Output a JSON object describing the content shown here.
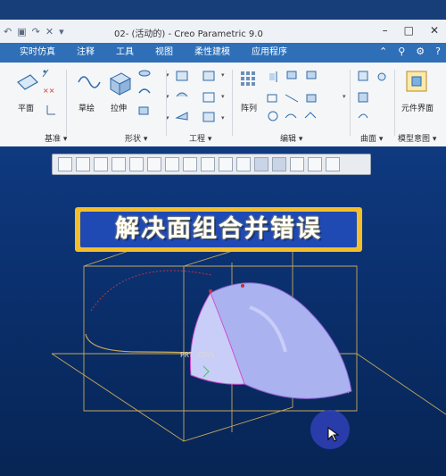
{
  "window": {
    "title": "02- (活动的) - Creo Parametric 9.0"
  },
  "tabs": [
    "实时仿真",
    "注释",
    "工具",
    "视图",
    "柔性建模",
    "应用程序"
  ],
  "ribbon": {
    "groups": [
      {
        "label": "基准 ▾",
        "buttons": [
          "平面",
          "草绘"
        ]
      },
      {
        "label": "形状 ▾",
        "buttons": [
          "拉伸"
        ]
      },
      {
        "label": "工程 ▾",
        "buttons": []
      },
      {
        "label": "编辑 ▾",
        "buttons": [
          "阵列"
        ]
      },
      {
        "label": "曲面 ▾",
        "buttons": []
      },
      {
        "label": "模型意图 ▾",
        "buttons": [
          "元件界面"
        ]
      }
    ]
  },
  "overlay": {
    "banner_text": "解决面组合并错误"
  },
  "colors": {
    "tab_bar": "#2e6fb8",
    "banner_fill": "#1f49b3",
    "banner_border": "#f3be2a",
    "surface": "#aab2f0",
    "viewport": "#0b2f6c"
  }
}
